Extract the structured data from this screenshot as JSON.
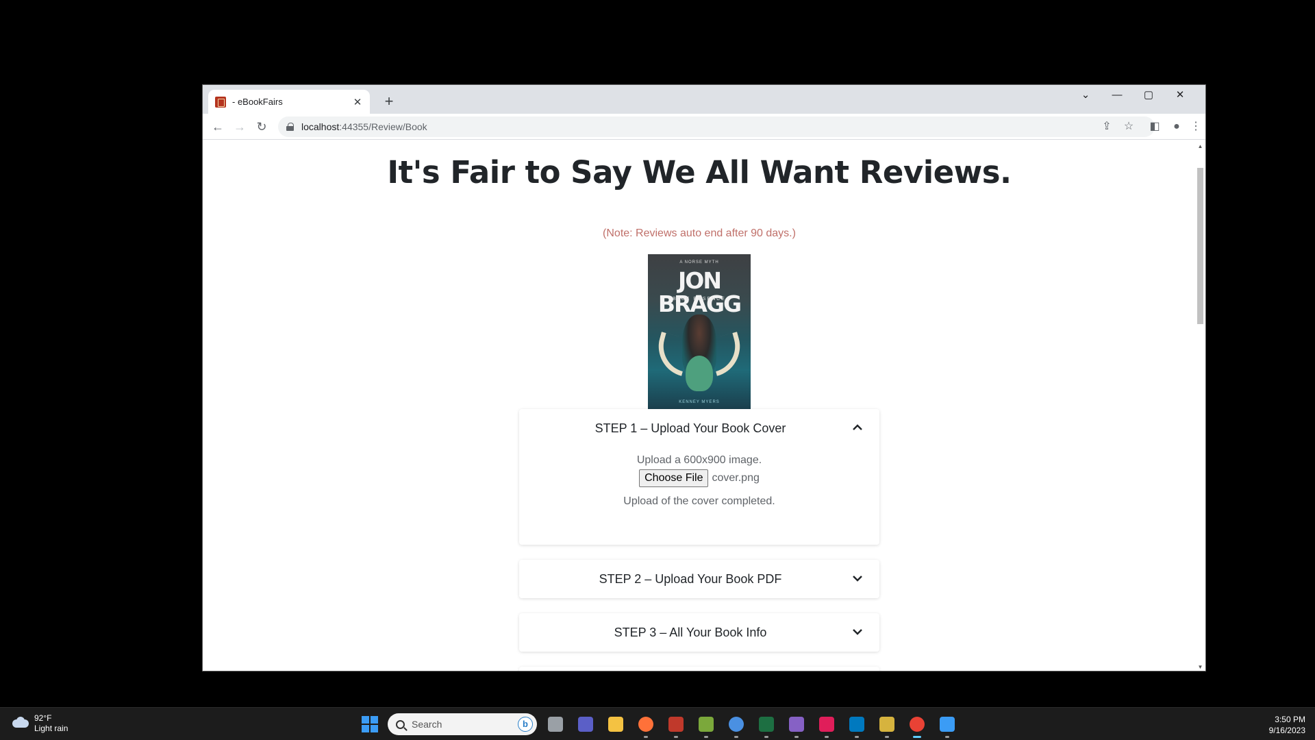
{
  "browser": {
    "tab_title": "- eBookFairs",
    "tab_close": "✕",
    "new_tab": "+",
    "url_host": "localhost",
    "url_rest": ":44355/Review/Book"
  },
  "page": {
    "heading": "It's Fair to Say We All Want Reviews.",
    "note": "(Note: Reviews auto end after 90 days.)",
    "cover": {
      "top_text": "A NORSE MYTH",
      "title": "JON BRAGG",
      "subtitle": "BLUE ESSENCE",
      "author": "KENNEY MYERS"
    },
    "steps": [
      {
        "title": "STEP 1 – Upload Your Book Cover",
        "expanded": true,
        "upload_hint": "Upload a 600x900 image.",
        "choose_button": "Choose File",
        "file_name": "cover.png",
        "status": "Upload of the cover completed."
      },
      {
        "title": "STEP 2 – Upload Your Book PDF",
        "expanded": false
      },
      {
        "title": "STEP 3 – All Your Book Info",
        "expanded": false
      }
    ]
  },
  "taskbar": {
    "weather_temp": "92°F",
    "weather_desc": "Light rain",
    "search_placeholder": "Search",
    "bing_label": "b",
    "time": "3:50 PM",
    "date": "9/16/2023",
    "apps": [
      {
        "name": "task-view",
        "color": "#9aa0a6"
      },
      {
        "name": "teams",
        "color": "#5b5fc7"
      },
      {
        "name": "file-explorer",
        "color": "#f4c242"
      },
      {
        "name": "firefox",
        "color": "#ff7139"
      },
      {
        "name": "app-x",
        "color": "#c0392b"
      },
      {
        "name": "app-green-doc",
        "color": "#7ba83b"
      },
      {
        "name": "chrome-alt",
        "color": "#4a90e2"
      },
      {
        "name": "excel",
        "color": "#1d6f42"
      },
      {
        "name": "visual-studio",
        "color": "#8661c5"
      },
      {
        "name": "slack",
        "color": "#e01e5a"
      },
      {
        "name": "trello",
        "color": "#0079bf"
      },
      {
        "name": "app-yellow",
        "color": "#d6b33e"
      },
      {
        "name": "chrome",
        "color": "#e94235"
      },
      {
        "name": "app-blue",
        "color": "#3b9cf5"
      }
    ]
  }
}
